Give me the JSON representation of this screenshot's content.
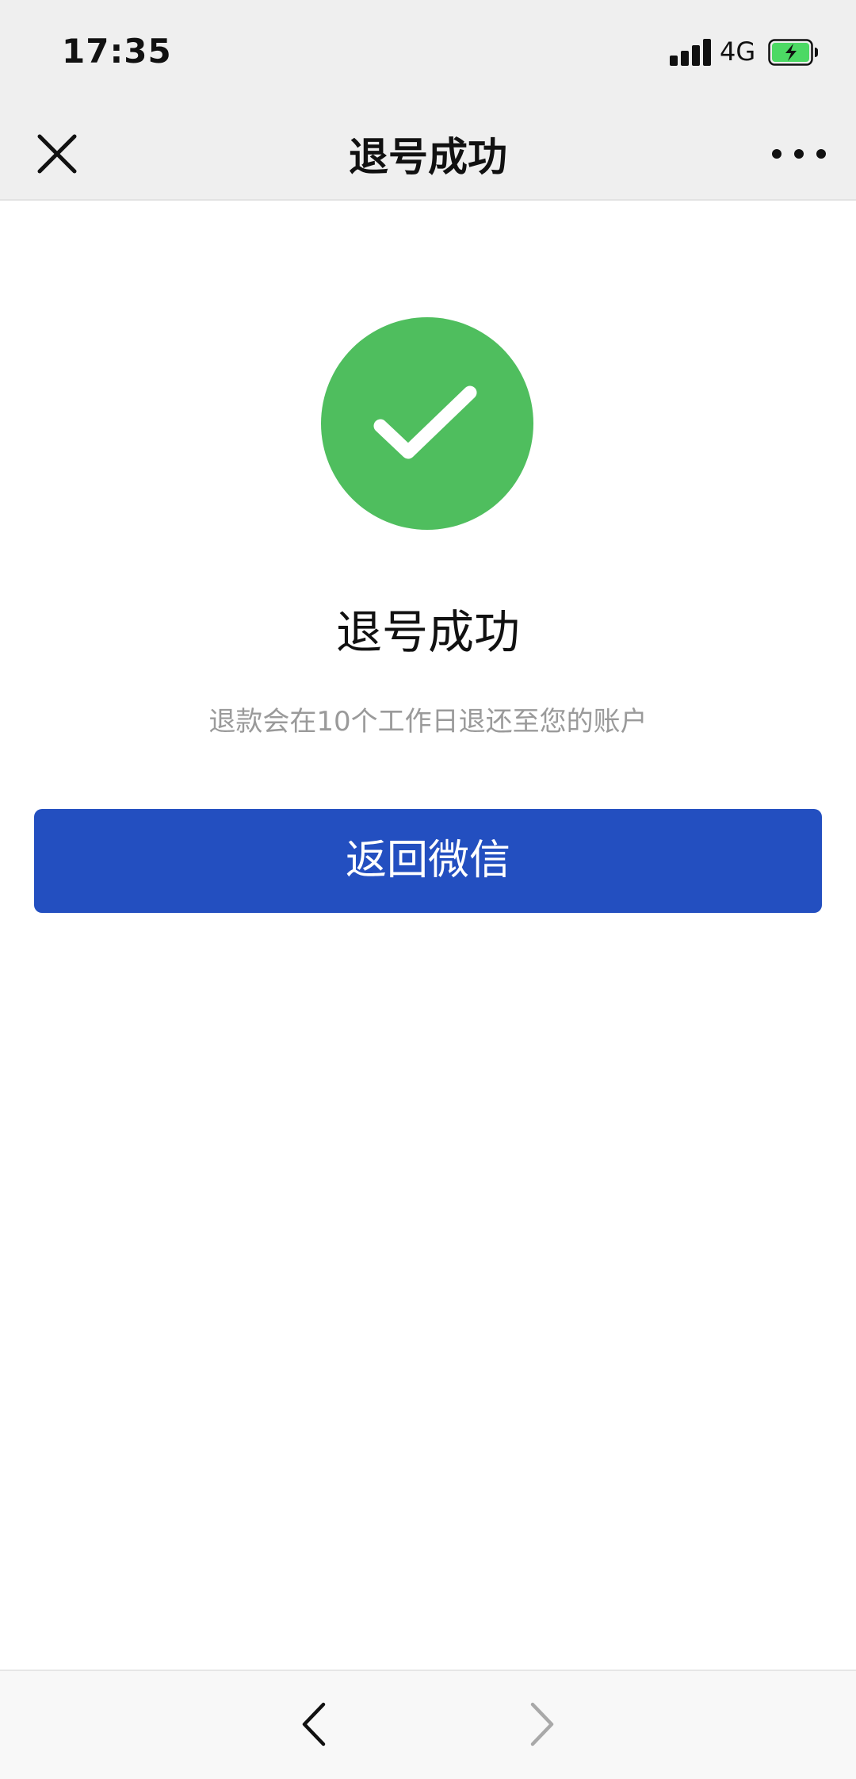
{
  "status_bar": {
    "time": "17:35",
    "network": "4G",
    "signal_icon": "cellular-signal-icon",
    "battery_icon": "battery-charging-icon",
    "signal_bars_filled": 4
  },
  "header": {
    "title": "退号成功",
    "close_icon": "close-icon",
    "more_icon": "more-dots-icon"
  },
  "result": {
    "icon": "success-check-icon",
    "title": "退号成功",
    "description": "退款会在10个工作日退还至您的账户"
  },
  "actions": {
    "return_label": "返回微信"
  },
  "toolbar": {
    "back_icon": "chevron-left-icon",
    "forward_icon": "chevron-right-icon",
    "forward_enabled": false
  },
  "colors": {
    "success_green": "#4fbe5e",
    "button_blue": "#234fc0",
    "battery_green": "#4cd964",
    "header_bg": "#efefef",
    "secondary_text": "#9a9a9a"
  }
}
